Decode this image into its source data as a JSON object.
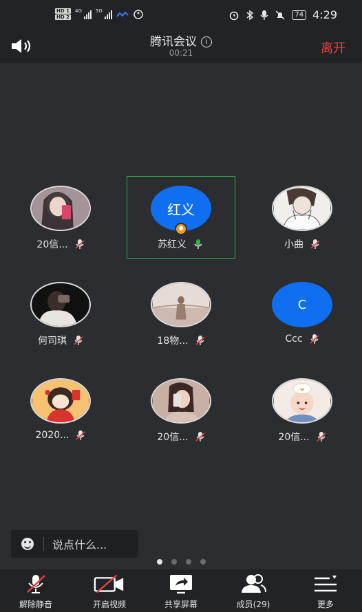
{
  "status_bar": {
    "hd1": "HD 1",
    "hd2": "HD 2",
    "net1": "4G",
    "net2": "5G",
    "battery": "74",
    "time": "4:29"
  },
  "header": {
    "title": "腾讯会议",
    "info_glyph": "i",
    "timer": "00:21",
    "leave_label": "离开"
  },
  "participants": [
    {
      "name": "20信...",
      "avatar_type": "photo",
      "mic": "muted"
    },
    {
      "name": "苏红义",
      "avatar_type": "text",
      "avatar_text": "红义",
      "mic": "on",
      "active": true,
      "host": true
    },
    {
      "name": "小曲",
      "avatar_type": "photo",
      "mic": "muted"
    },
    {
      "name": "何司琪",
      "avatar_type": "photo",
      "mic": "muted"
    },
    {
      "name": "18物...",
      "avatar_type": "photo",
      "mic": "muted"
    },
    {
      "name": "Ccc",
      "avatar_type": "text",
      "avatar_text": "C",
      "mic": "muted"
    },
    {
      "name": "2020...",
      "avatar_type": "photo",
      "mic": "muted"
    },
    {
      "name": "20信...",
      "avatar_type": "photo",
      "mic": "muted"
    },
    {
      "name": "20信...",
      "avatar_type": "photo",
      "mic": "muted"
    }
  ],
  "chat": {
    "placeholder": "说点什么..."
  },
  "pager": {
    "pages": 4,
    "current": 1
  },
  "toolbar": {
    "unmute": "解除静音",
    "video": "开启视频",
    "share": "共享屏幕",
    "members": "成员(29)",
    "more": "更多"
  },
  "colors": {
    "accent_blue": "#0f6ff0",
    "leave_red": "#e8423b",
    "active_border": "#2fae4e",
    "muted_red": "#e8423b"
  }
}
